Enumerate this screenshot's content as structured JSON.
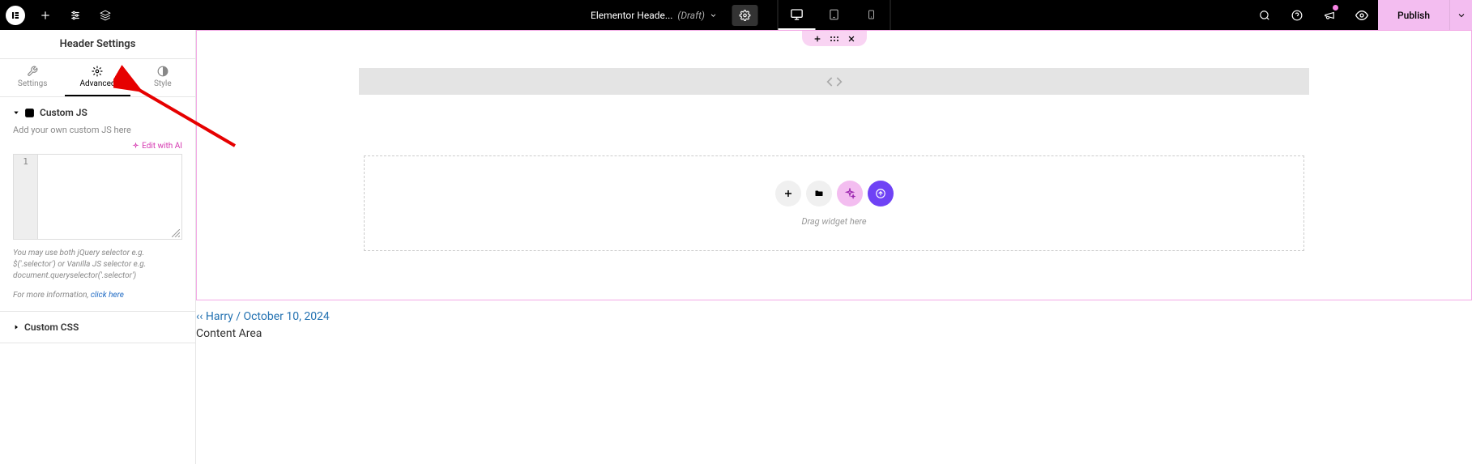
{
  "topbar": {
    "logo_glyph": "E",
    "doc_title": "Elementor Heade...",
    "doc_status": "(Draft)",
    "publish_label": "Publish"
  },
  "sidebar": {
    "title": "Header Settings",
    "tabs": {
      "settings": "Settings",
      "advanced": "Advanced",
      "style": "Style"
    },
    "custom_js": {
      "title": "Custom JS",
      "help": "Add your own custom JS here",
      "edit_ai": "Edit with AI",
      "line_no": "1",
      "hint1": "You may use both jQuery selector e.g. $('.selector') or Vanilla JS selector e.g. document.queryselector('.selector')",
      "hint2_prefix": "For more information, ",
      "hint2_link": "click here"
    },
    "custom_css": {
      "title": "Custom CSS"
    }
  },
  "canvas": {
    "drag_text": "Drag widget here",
    "meta_author": "Harry",
    "meta_sep": " / ",
    "meta_date": "October 10, 2024",
    "content_area": "Content Area"
  }
}
